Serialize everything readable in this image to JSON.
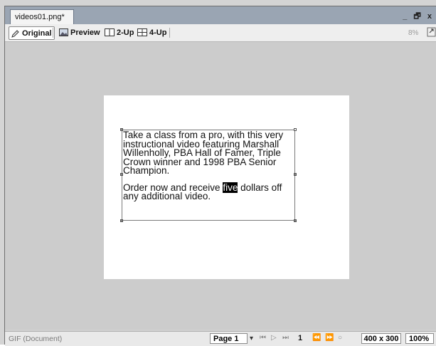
{
  "document": {
    "tab_title": "videos01.png*",
    "window_controls": "_ ð x"
  },
  "toolbar": {
    "original_label": "Original",
    "preview_label": "Preview",
    "two_up_label": "2-Up",
    "four_up_label": "4-Up"
  },
  "canvas": {
    "paragraph1": "Take a class from a pro, with this very instructional video featuring Marshall Willenholly, PBA Hall of Famer, Triple Crown winner and 1998 PBA Senior Champion.",
    "paragraph2_before": "Order now and receive ",
    "paragraph2_selected": "five",
    "paragraph2_after": " dollars off any additional video."
  },
  "status_bar": {
    "format_label": "GIF (Document)",
    "page_label": "Page 1",
    "frame_number": "1",
    "image_size": "400 x 300",
    "zoom": "100%"
  },
  "icons": {
    "original": "pencil-icon",
    "preview": "image-preview-icon",
    "two_up": "two-up-icon",
    "four_up": "four-up-icon"
  }
}
